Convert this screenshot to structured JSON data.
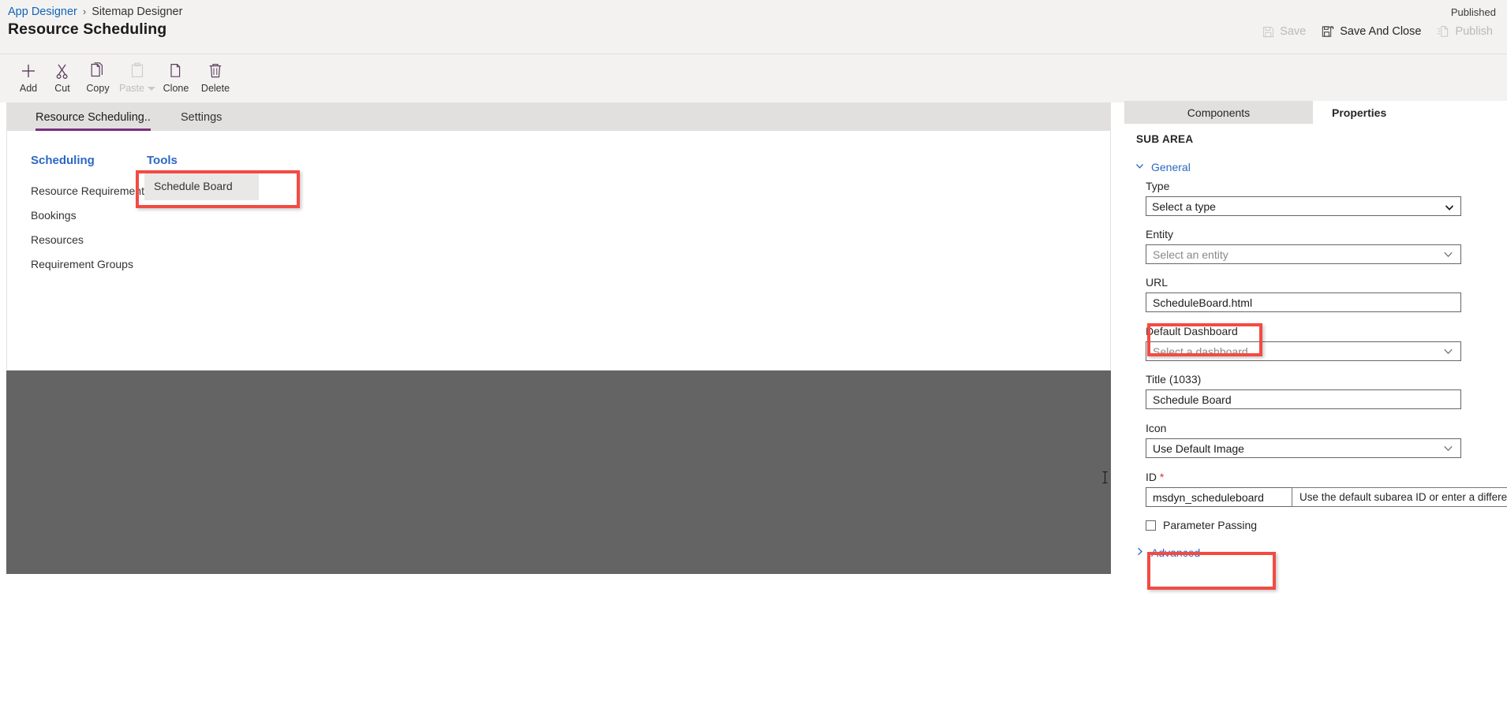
{
  "header": {
    "breadcrumb": {
      "root": "App Designer",
      "separator": "›",
      "current": "Sitemap Designer"
    },
    "page_title": "Resource Scheduling",
    "status": "Published",
    "commands": [
      {
        "name": "save",
        "label": "Save",
        "icon": "save-icon",
        "enabled": false
      },
      {
        "name": "save-and-close",
        "label": "Save And Close",
        "icon": "save-and-close-icon",
        "enabled": true
      },
      {
        "name": "publish",
        "label": "Publish",
        "icon": "publish-icon",
        "enabled": false
      }
    ]
  },
  "toolbar": {
    "items": [
      {
        "name": "add",
        "label": "Add",
        "icon": "plus-icon",
        "enabled": true
      },
      {
        "name": "cut",
        "label": "Cut",
        "icon": "scissors-icon",
        "enabled": true
      },
      {
        "name": "copy",
        "label": "Copy",
        "icon": "copy-icon",
        "enabled": true
      },
      {
        "name": "paste",
        "label": "Paste",
        "icon": "clipboard-icon",
        "enabled": false
      },
      {
        "name": "clone",
        "label": "Clone",
        "icon": "clone-icon",
        "enabled": true
      },
      {
        "name": "delete",
        "label": "Delete",
        "icon": "trash-icon",
        "enabled": true
      }
    ]
  },
  "designer": {
    "tabs": [
      {
        "label": "Resource Scheduling..",
        "active": true
      },
      {
        "label": "Settings",
        "active": false
      }
    ],
    "groups": [
      {
        "title": "Scheduling",
        "title_color": "#2b68c4",
        "items": [
          "Resource Requirements",
          "Bookings",
          "Resources",
          "Requirement Groups"
        ]
      },
      {
        "title": "Tools",
        "title_color": "#2b68c4",
        "items": [
          "Schedule Board"
        ]
      }
    ],
    "selected_subarea": "Schedule Board"
  },
  "properties": {
    "tabs": [
      {
        "label": "Components",
        "active": false
      },
      {
        "label": "Properties",
        "active": true
      }
    ],
    "section_header": "SUB AREA",
    "general": {
      "label": "General",
      "expanded": true,
      "chevron": "chevron-down-icon"
    },
    "fields": [
      {
        "name": "type",
        "label": "Type",
        "control": "select",
        "value": "Select a type",
        "placeholder": "",
        "options": [
          "Select a type"
        ],
        "disabled": false
      },
      {
        "name": "entity",
        "label": "Entity",
        "control": "combobox",
        "value": "",
        "placeholder": "Select an entity",
        "disabled": true
      },
      {
        "name": "url",
        "label": "URL",
        "control": "text",
        "value": "ScheduleBoard.html",
        "placeholder": ""
      },
      {
        "name": "default-dashboard",
        "label": "Default Dashboard",
        "control": "combobox",
        "value": "",
        "placeholder": "Select a dashboard",
        "disabled": true
      },
      {
        "name": "title-1033",
        "label": "Title (1033)",
        "control": "text",
        "value": "Schedule Board",
        "placeholder": ""
      },
      {
        "name": "icon",
        "label": "Icon",
        "control": "combobox",
        "value": "Use Default Image",
        "placeholder": "",
        "disabled": false
      },
      {
        "name": "id",
        "label": "ID",
        "required": true,
        "required_mark": "*",
        "control": "text",
        "value": "msdyn_scheduleboard",
        "placeholder": ""
      }
    ],
    "checkbox": {
      "name": "parameter-passing",
      "label": "Parameter Passing",
      "checked": false
    },
    "advanced": {
      "label": "Advanced",
      "expanded": false,
      "chevron": "chevron-right-icon"
    },
    "tooltip": "Use the default subarea ID or enter a different one."
  },
  "annotations": {
    "color": "#f24b43",
    "boxes": [
      "schedule-board-tile",
      "url-field",
      "id-field"
    ]
  }
}
